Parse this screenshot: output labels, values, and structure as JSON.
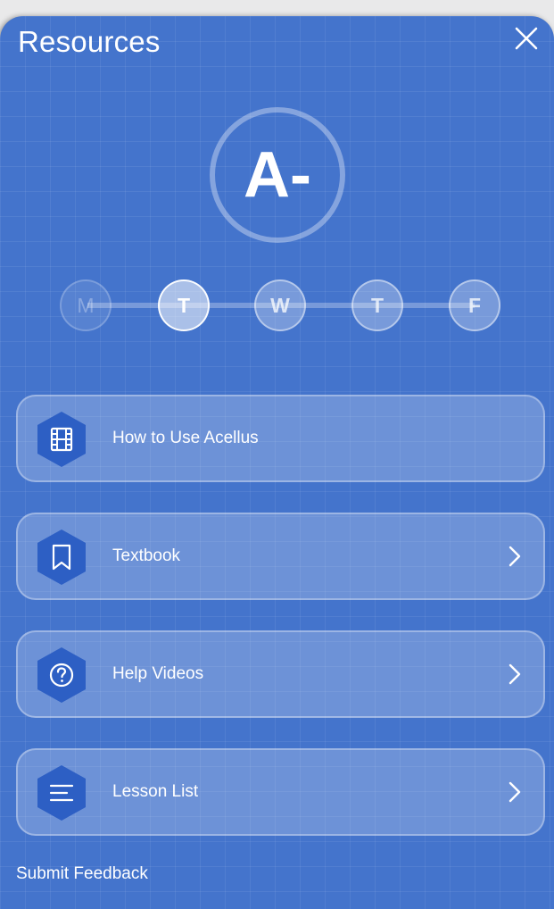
{
  "header": {
    "title": "Resources",
    "close_icon": "close-icon"
  },
  "grade": {
    "value": "A-"
  },
  "week": {
    "days": [
      {
        "letter": "M",
        "state": "past"
      },
      {
        "letter": "T",
        "state": "today"
      },
      {
        "letter": "W",
        "state": "future"
      },
      {
        "letter": "T",
        "state": "future"
      },
      {
        "letter": "F",
        "state": "future"
      }
    ]
  },
  "resources": [
    {
      "label": "How to Use Acellus",
      "icon": "film-icon",
      "has_chevron": false
    },
    {
      "label": "Textbook",
      "icon": "bookmark-icon",
      "has_chevron": true
    },
    {
      "label": "Help Videos",
      "icon": "help-circle-icon",
      "has_chevron": true
    },
    {
      "label": "Lesson List",
      "icon": "list-icon",
      "has_chevron": true
    }
  ],
  "footer": {
    "feedback_label": "Submit Feedback"
  },
  "colors": {
    "panel_bg": "#4474cc",
    "hex_icon_bg": "#2d5fc4"
  }
}
